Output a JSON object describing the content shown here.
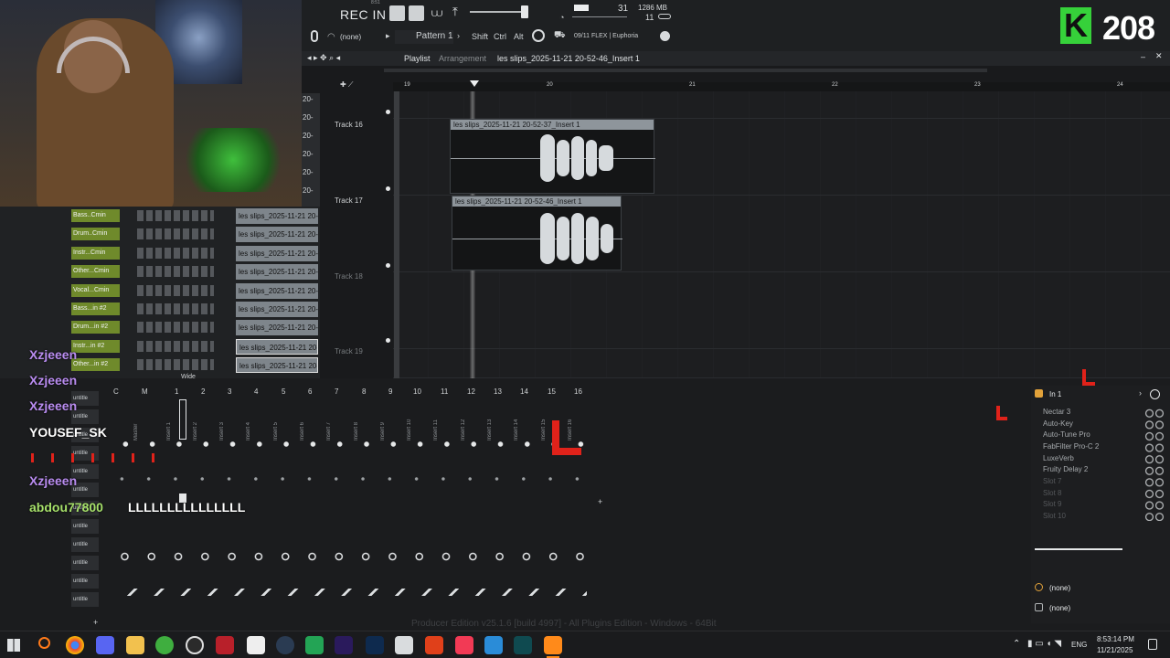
{
  "toolbar": {
    "rec_label": "REC IN 1",
    "small_top": "8:51",
    "tempo_text": "31",
    "memory_text": "1286 MB",
    "voices_text": "11",
    "pattern_none": "(none)",
    "pattern_label": "Pattern 1",
    "shift_label": "Shift",
    "ctrl_label": "Ctrl",
    "alt_label": "Alt",
    "hint_text": "09/11  FLEX | Euphoria"
  },
  "playlist": {
    "title": "Playlist",
    "subtitle": "Arrangement",
    "clip_name": "les slips_2025-11-21 20-52-46_Insert 1",
    "bar_numbers": [
      "19",
      "20",
      "21",
      "22",
      "23",
      "24"
    ],
    "tracks": [
      "Track 16",
      "Track 17",
      "Track 18",
      "Track 19"
    ],
    "left_numbers": [
      "20-",
      "20-",
      "20-",
      "20-",
      "20-",
      "20-"
    ],
    "clips": [
      {
        "label": "les slips_2025-11-21 20-52-37_Insert 1"
      },
      {
        "label": "les slips_2025-11-21 20-52-46_Insert 1"
      }
    ]
  },
  "rack": {
    "channels": [
      {
        "name": "Bass..Cmin",
        "clip": "les slips_2025-11-21 20-"
      },
      {
        "name": "Drum..Cmin",
        "clip": "les slips_2025-11-21 20-"
      },
      {
        "name": "Instr...Cmin",
        "clip": "les slips_2025-11-21 20-"
      },
      {
        "name": "Other...Cmin",
        "clip": "les slips_2025-11-21 20-"
      },
      {
        "name": "Vocal...Cmin",
        "clip": "les slips_2025-11-21 20-"
      },
      {
        "name": "Bass...in #2",
        "clip": "les slips_2025-11-21 20-"
      },
      {
        "name": "Drum...in #2",
        "clip": "les slips_2025-11-21 20-"
      },
      {
        "name": "Instr...in #2",
        "clip": "les slips_2025-11-21 20-"
      },
      {
        "name": "Other...in #2",
        "clip": "les slips_2025-11-21 20-"
      }
    ],
    "untitled_labels": [
      "untitle",
      "untitle",
      "untitle",
      "untitle",
      "untitle",
      "untitle",
      "untitle",
      "untitle",
      "untitle",
      "untitle",
      "untitle",
      "untitle"
    ],
    "wide_label": "Wide"
  },
  "mixer": {
    "header_labels": [
      "C",
      "M",
      "1",
      "2",
      "3",
      "4",
      "5",
      "6",
      "7",
      "8",
      "9",
      "10",
      "11",
      "12",
      "13",
      "14",
      "15",
      "16"
    ],
    "insert_names": [
      "Master",
      "Insert 1",
      "Insert 2",
      "Insert 3",
      "Insert 4",
      "Insert 5",
      "Insert 6",
      "Insert 7",
      "Insert 8",
      "Insert 9",
      "Insert 10",
      "Insert 11",
      "Insert 12",
      "Insert 13",
      "Insert 14",
      "Insert 15",
      "Insert 16"
    ]
  },
  "fx": {
    "input": "In 1",
    "slots": [
      "Nectar 3",
      "Auto-Key",
      "Auto-Tune Pro",
      "FabFilter Pro-C 2",
      "LuxeVerb",
      "Fruity Delay 2",
      "Slot 7",
      "Slot 8",
      "Slot 9",
      "Slot 10"
    ],
    "out1": "(none)",
    "out2": "(none)"
  },
  "footer_text": "Producer Edition v25.1.6 [build 4997] - All Plugins Edition - Windows - 64Bit",
  "chat": [
    {
      "user": "Xzjeeen",
      "msg": ""
    },
    {
      "user": "Xzjeeen",
      "msg": ""
    },
    {
      "user": "Xzjeeen",
      "msg": ""
    },
    {
      "user": "YOUSEF_SK",
      "msg": ""
    },
    {
      "user": "Xzjeeen",
      "msg": ""
    },
    {
      "user": "abdou77800",
      "msg": "LLLLLLLLLLLLLLL"
    }
  ],
  "counter": {
    "letter": "K",
    "value": "208"
  },
  "taskbar": {
    "lang": "ENG",
    "time": "8:53:14 PM",
    "date": "11/21/2025"
  },
  "colors": {
    "accent_green": "#7fcf26",
    "counter_green": "#36d13a",
    "clip_header": "#8e959b",
    "red_l": "#e0221a"
  }
}
